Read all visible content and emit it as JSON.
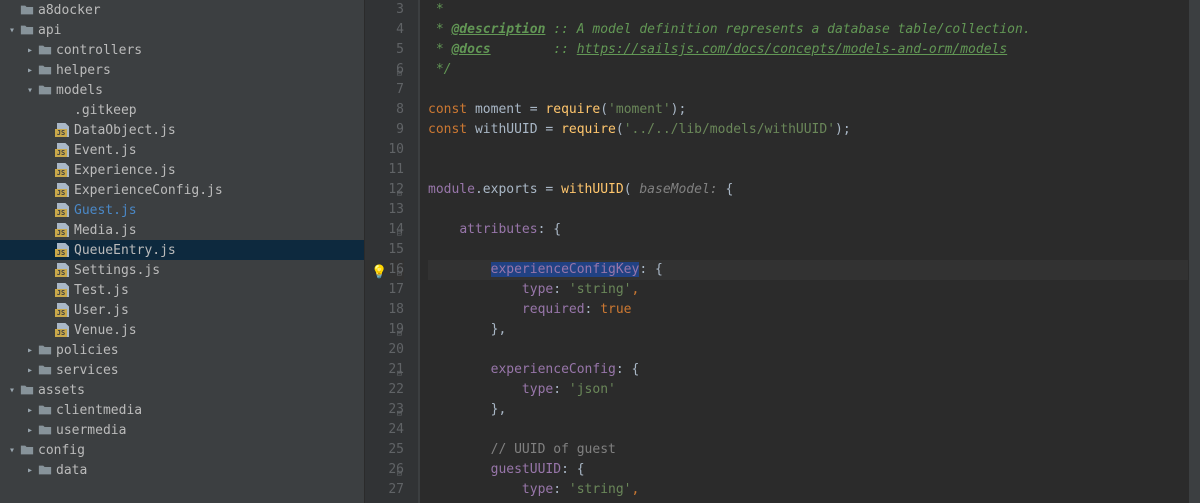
{
  "tree": [
    {
      "depth": 0,
      "arrow": "",
      "icon": "folder",
      "label": "a8docker",
      "active": false,
      "selected": false
    },
    {
      "depth": 0,
      "arrow": "down",
      "icon": "folder",
      "label": "api",
      "active": false,
      "selected": false
    },
    {
      "depth": 1,
      "arrow": "right",
      "icon": "folder",
      "label": "controllers",
      "active": false,
      "selected": false
    },
    {
      "depth": 1,
      "arrow": "right",
      "icon": "folder",
      "label": "helpers",
      "active": false,
      "selected": false
    },
    {
      "depth": 1,
      "arrow": "down",
      "icon": "folder",
      "label": "models",
      "active": false,
      "selected": false
    },
    {
      "depth": 2,
      "arrow": "",
      "icon": "file",
      "label": ".gitkeep",
      "active": false,
      "selected": false
    },
    {
      "depth": 2,
      "arrow": "",
      "icon": "js",
      "label": "DataObject.js",
      "active": false,
      "selected": false
    },
    {
      "depth": 2,
      "arrow": "",
      "icon": "js",
      "label": "Event.js",
      "active": false,
      "selected": false
    },
    {
      "depth": 2,
      "arrow": "",
      "icon": "js",
      "label": "Experience.js",
      "active": false,
      "selected": false
    },
    {
      "depth": 2,
      "arrow": "",
      "icon": "js",
      "label": "ExperienceConfig.js",
      "active": false,
      "selected": false
    },
    {
      "depth": 2,
      "arrow": "",
      "icon": "js",
      "label": "Guest.js",
      "active": true,
      "selected": false
    },
    {
      "depth": 2,
      "arrow": "",
      "icon": "js",
      "label": "Media.js",
      "active": false,
      "selected": false
    },
    {
      "depth": 2,
      "arrow": "",
      "icon": "js",
      "label": "QueueEntry.js",
      "active": false,
      "selected": true
    },
    {
      "depth": 2,
      "arrow": "",
      "icon": "js",
      "label": "Settings.js",
      "active": false,
      "selected": false
    },
    {
      "depth": 2,
      "arrow": "",
      "icon": "js",
      "label": "Test.js",
      "active": false,
      "selected": false
    },
    {
      "depth": 2,
      "arrow": "",
      "icon": "js",
      "label": "User.js",
      "active": false,
      "selected": false
    },
    {
      "depth": 2,
      "arrow": "",
      "icon": "js",
      "label": "Venue.js",
      "active": false,
      "selected": false
    },
    {
      "depth": 1,
      "arrow": "right",
      "icon": "folder",
      "label": "policies",
      "active": false,
      "selected": false
    },
    {
      "depth": 1,
      "arrow": "right",
      "icon": "folder",
      "label": "services",
      "active": false,
      "selected": false
    },
    {
      "depth": 0,
      "arrow": "down",
      "icon": "folder",
      "label": "assets",
      "active": false,
      "selected": false
    },
    {
      "depth": 1,
      "arrow": "right",
      "icon": "folder",
      "label": "clientmedia",
      "active": false,
      "selected": false
    },
    {
      "depth": 1,
      "arrow": "right",
      "icon": "folder",
      "label": "usermedia",
      "active": false,
      "selected": false
    },
    {
      "depth": 0,
      "arrow": "down",
      "icon": "folder",
      "label": "config",
      "active": false,
      "selected": false
    },
    {
      "depth": 1,
      "arrow": "right",
      "icon": "folder",
      "label": "data",
      "active": false,
      "selected": false
    }
  ],
  "gutter_start": 3,
  "gutter_end": 27,
  "current_line": 16,
  "code": {
    "l3": {
      "star": " *"
    },
    "l4": {
      "star": " * ",
      "tag": "@description",
      "rest": " :: A model definition represents a database table/collection."
    },
    "l5": {
      "star": " * ",
      "tag": "@docs",
      "pad": "        :: ",
      "link": "https://sailsjs.com/docs/concepts/models-and-orm/models"
    },
    "l6": {
      "star": " */"
    },
    "l8": {
      "kw1": "const ",
      "v": "moment",
      "eq": " = ",
      "fn": "require",
      "p1": "(",
      "s": "'moment'",
      "p2": ");"
    },
    "l9": {
      "kw1": "const ",
      "v": "withUUID",
      "eq": " = ",
      "fn": "require",
      "p1": "(",
      "s": "'../../lib/models/withUUID'",
      "p2": ");"
    },
    "l12": {
      "mod": "module",
      "dot": ".exports = ",
      "fn": "withUUID",
      "p1": "( ",
      "param": "baseModel:",
      "p2": " {"
    },
    "l14": {
      "prop": "attributes",
      "c": ": {"
    },
    "l16": {
      "prop": "experienceConfigKey",
      "c": ": {"
    },
    "l17": {
      "prop": "type",
      "c": ": ",
      "s": "'string'",
      "t": ","
    },
    "l18": {
      "prop": "required",
      "c": ": ",
      "kw": "true"
    },
    "l19": {
      "c": "},"
    },
    "l21": {
      "prop": "experienceConfig",
      "c": ": {"
    },
    "l22": {
      "prop": "type",
      "c": ": ",
      "s": "'json'"
    },
    "l23": {
      "c": "},"
    },
    "l25": {
      "c": "// UUID of guest"
    },
    "l26": {
      "prop": "guestUUID",
      "c": ": {"
    },
    "l27": {
      "prop": "type",
      "c": ": ",
      "s": "'string'",
      "t": ","
    }
  }
}
